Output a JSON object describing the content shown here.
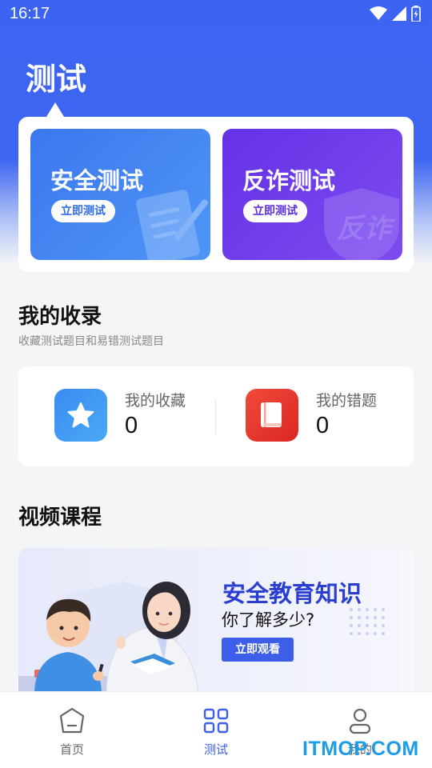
{
  "status_bar": {
    "time": "16:17"
  },
  "page": {
    "title": "测试"
  },
  "tests": [
    {
      "title": "安全测试",
      "button": "立即测试"
    },
    {
      "title": "反诈测试",
      "button": "立即测试",
      "deco_text": "反诈"
    }
  ],
  "collection": {
    "title": "我的收录",
    "subtitle": "收藏测试题目和易错测试题目",
    "items": [
      {
        "label": "我的收藏",
        "count": "0",
        "icon": "star-icon"
      },
      {
        "label": "我的错题",
        "count": "0",
        "icon": "book-icon"
      }
    ]
  },
  "videos": {
    "title": "视频课程",
    "banner": {
      "title": "安全教育知识",
      "subtitle": "你了解多少?",
      "button": "立即观看"
    }
  },
  "tab_bar": {
    "items": [
      {
        "label": "首页",
        "icon": "home-icon",
        "active": false
      },
      {
        "label": "测试",
        "icon": "grid-icon",
        "active": true
      },
      {
        "label": "我的",
        "icon": "user-icon",
        "active": false
      }
    ]
  },
  "watermark": "ITMOP.COM",
  "colors": {
    "primary": "#3d5ee8",
    "safety_card": "#3c77ee",
    "fraud_card": "#6431e6",
    "favorite_icon": "#3b8cf0",
    "wrong_icon": "#e8372b"
  }
}
